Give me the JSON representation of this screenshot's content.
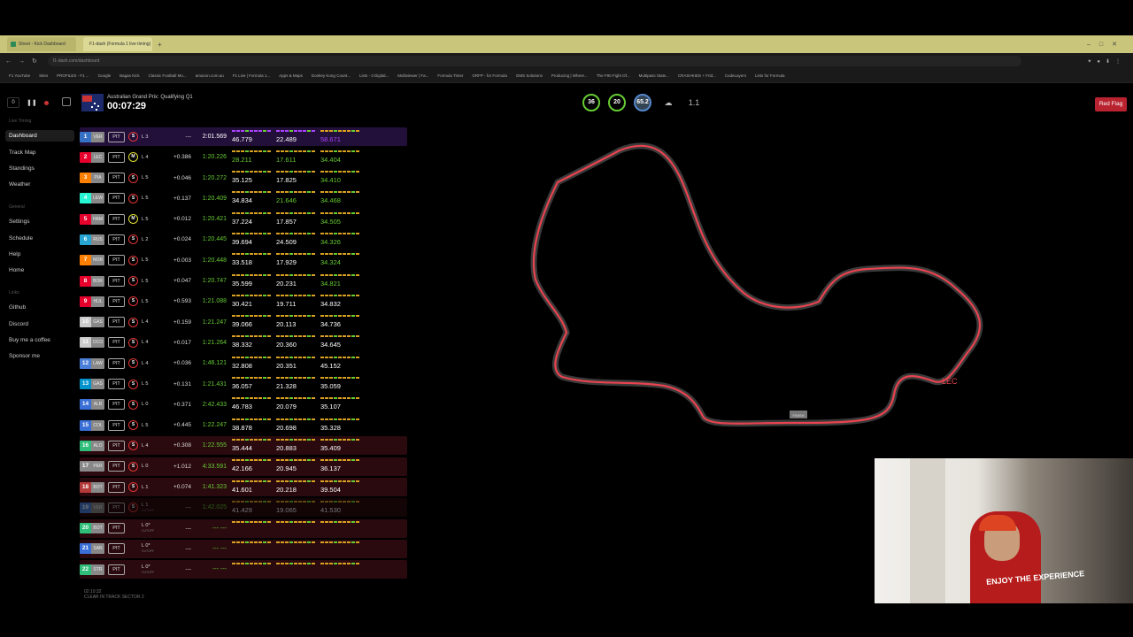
{
  "browser": {
    "tabs": [
      "Sheet - Kick Dashboard",
      "F1-dash (Formula 1 live timing)"
    ],
    "new_tab": "+",
    "url": "f1-dash.com/dashboard",
    "bookmarks": [
      "F1 YouTube",
      "Sites",
      "PROFILES - F1 ...",
      "Google",
      "Bagas Kick",
      "Classic Football Mo...",
      "amazon.com.au",
      "F1 Live | Formula 1...",
      "Apps & Maps",
      "Donkey Kong Count...",
      "Lists - 3 Digital...",
      "Multiviewer | Fa...",
      "Formula Timer",
      "GRFP - for Formula",
      "GMS Solutions",
      "Producing | Where...",
      "The F90 Fight Of...",
      "Multipass Stats...",
      "CRASHKIDS + Frid...",
      "CodeLayers",
      "Lists for Formula"
    ]
  },
  "sidebar": {
    "sections": {
      "live": "Live Timing",
      "general": "General",
      "links": "Links"
    },
    "live_items": [
      "Dashboard",
      "Track Map",
      "Standings",
      "Weather"
    ],
    "general_items": [
      "Settings",
      "Schedule",
      "Help",
      "Home"
    ],
    "link_items": [
      "Github",
      "Discord",
      "Buy me a coffee",
      "Sponsor me"
    ],
    "delay": "0"
  },
  "header": {
    "session": "Australian Grand Prix: Qualifying Q1",
    "clock": "00:07:29",
    "gauges": [
      "36",
      "20",
      "65.2",
      "",
      "1.1"
    ],
    "status": "Red Flag"
  },
  "colors": {
    "accent_green": "#66cc33",
    "purple": "#aa44ff",
    "yellow": "#d9a021",
    "red_flag": "#b8232f",
    "track_red": "#e8434f"
  },
  "drivers": [
    {
      "pos": "1",
      "team": "VER",
      "color": "#3671c6",
      "tyre": "S",
      "lap": "L 3",
      "gap": "---",
      "best": "2:01.569",
      "s1": "46.779",
      "s2": "22.489",
      "s3": "58.671",
      "style": "purple"
    },
    {
      "pos": "2",
      "team": "LEC",
      "color": "#e8002d",
      "tyre": "M",
      "lap": "L 4",
      "gap": "+0.386",
      "best": "1:20.226",
      "s1": "28.211",
      "s2": "17.611",
      "s3": "34.404",
      "style": ""
    },
    {
      "pos": "3",
      "team": "PIA",
      "color": "#ff8000",
      "tyre": "S",
      "lap": "L 5",
      "gap": "+0.046",
      "best": "1:20.272",
      "s1": "35.125",
      "s2": "17.825",
      "s3": "34.410",
      "style": ""
    },
    {
      "pos": "4",
      "team": "LEW",
      "color": "#27f4d2",
      "tyre": "S",
      "lap": "L 5",
      "gap": "+0.137",
      "best": "1:20.409",
      "s1": "34.834",
      "s2": "21.646",
      "s3": "34.468",
      "style": ""
    },
    {
      "pos": "5",
      "team": "HAM",
      "color": "#e8002d",
      "tyre": "M",
      "lap": "L 5",
      "gap": "+0.012",
      "best": "1:20.421",
      "s1": "37.224",
      "s2": "17.857",
      "s3": "34.505",
      "style": ""
    },
    {
      "pos": "6",
      "team": "RUS",
      "color": "#27a4d2",
      "tyre": "S",
      "lap": "L 2",
      "gap": "+0.024",
      "best": "1:20.445",
      "s1": "39.694",
      "s2": "24.509",
      "s3": "34.326",
      "style": ""
    },
    {
      "pos": "7",
      "team": "NOR",
      "color": "#ff8000",
      "tyre": "S",
      "lap": "L 5",
      "gap": "+0.003",
      "best": "1:20.448",
      "s1": "33.518",
      "s2": "17.929",
      "s3": "34.324",
      "style": ""
    },
    {
      "pos": "8",
      "team": "BOR",
      "color": "#e8002d",
      "tyre": "S",
      "lap": "L 5",
      "gap": "+0.047",
      "best": "1:20.747",
      "s1": "35.599",
      "s2": "20.231",
      "s3": "34.821",
      "style": ""
    },
    {
      "pos": "9",
      "team": "HUL",
      "color": "#e8002d",
      "tyre": "S",
      "lap": "L 5",
      "gap": "+0.593",
      "best": "1:21.088",
      "s1": "30.421",
      "s2": "19.711",
      "s3": "34.832",
      "style": ""
    },
    {
      "pos": "10",
      "team": "GAS",
      "color": "#cccccc",
      "tyre": "S",
      "lap": "L 4",
      "gap": "+0.159",
      "best": "1:21.247",
      "s1": "39.066",
      "s2": "20.113",
      "s3": "34.736",
      "style": ""
    },
    {
      "pos": "11",
      "team": "OCO",
      "color": "#cccccc",
      "tyre": "S",
      "lap": "L 4",
      "gap": "+0.017",
      "best": "1:21.264",
      "s1": "38.332",
      "s2": "20.360",
      "s3": "34.645",
      "style": ""
    },
    {
      "pos": "12",
      "team": "LAW",
      "color": "#4a7fd8",
      "tyre": "S",
      "lap": "L 4",
      "gap": "+0.036",
      "best": "1:46.121",
      "s1": "32.808",
      "s2": "20.351",
      "s3": "45.152",
      "style": ""
    },
    {
      "pos": "13",
      "team": "GAS",
      "color": "#0093cc",
      "tyre": "S",
      "lap": "L 5",
      "gap": "+0.131",
      "best": "1:21.431",
      "s1": "36.057",
      "s2": "21.328",
      "s3": "35.059",
      "style": ""
    },
    {
      "pos": "14",
      "team": "ALB",
      "color": "#3a6fd8",
      "tyre": "S",
      "lap": "L 0",
      "gap": "+0.371",
      "best": "2:42.433",
      "s1": "46.783",
      "s2": "20.079",
      "s3": "35.107",
      "style": ""
    },
    {
      "pos": "15",
      "team": "COL",
      "color": "#3a6fd8",
      "tyre": "S",
      "lap": "L 5",
      "gap": "+0.445",
      "best": "1:22.247",
      "s1": "38.878",
      "s2": "20.698",
      "s3": "35.328",
      "style": ""
    },
    {
      "pos": "16",
      "team": "ALO",
      "color": "#2fbd7a",
      "tyre": "S",
      "lap": "L 4",
      "gap": "+0.308",
      "best": "1:22.555",
      "s1": "35.444",
      "s2": "20.883",
      "s3": "35.409",
      "style": "red"
    },
    {
      "pos": "17",
      "team": "PER",
      "color": "#888888",
      "tyre": "S",
      "lap": "L 0",
      "gap": "+1.012",
      "best": "4:33.591",
      "s1": "42.166",
      "s2": "20.945",
      "s3": "36.137",
      "style": "red"
    },
    {
      "pos": "18",
      "team": "BOT",
      "color": "#b53a3a",
      "tyre": "S",
      "lap": "L 1",
      "gap": "+0.074",
      "best": "1:41.323",
      "s1": "41.601",
      "s2": "20.218",
      "s3": "39.504",
      "style": "red"
    },
    {
      "pos": "19",
      "team": "VER",
      "color": "#4a7fd8",
      "tyre": "S",
      "lap": "L 1",
      "gap": "---",
      "best": "1:42.025",
      "s1": "41.429",
      "s2": "19.065",
      "s3": "41.530",
      "style": "red dim"
    },
    {
      "pos": "20",
      "team": "BOT",
      "color": "#2fbd7a",
      "tyre": "",
      "lap": "L 0*",
      "gap": "---",
      "best": "--- ---",
      "s1": "",
      "s2": "",
      "s3": "",
      "style": "red"
    },
    {
      "pos": "21",
      "team": "SAR",
      "color": "#3a6fd8",
      "tyre": "",
      "lap": "L 0*",
      "gap": "---",
      "best": "--- ---",
      "s1": "",
      "s2": "",
      "s3": "",
      "style": "red"
    },
    {
      "pos": "22",
      "team": "STR",
      "color": "#2fbd7a",
      "tyre": "",
      "lap": "L 0*",
      "gap": "---",
      "best": "--- ---",
      "s1": "",
      "s2": "",
      "s3": "",
      "style": "red"
    }
  ],
  "row_labels": {
    "pit": "PIT",
    "cutoff": "CUTOFF"
  },
  "track": {
    "driver_label": "LEC",
    "finish_label": "FINISH"
  },
  "footer": {
    "time": "02:10:32",
    "message": "CLEAR IN TRACK SECTOR 2"
  },
  "webcam": {
    "shirt_text": "ENJOY THE EXPERIENCE"
  }
}
